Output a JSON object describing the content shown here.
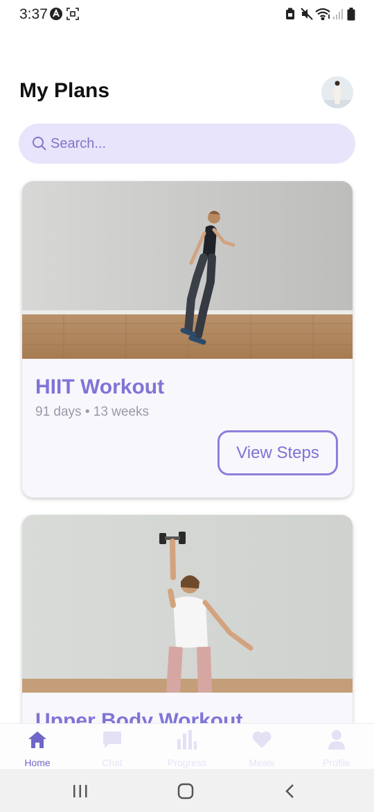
{
  "status_bar": {
    "time": "3:37",
    "icons": [
      "app-a-icon",
      "screenshot-icon",
      "battery-saver-icon",
      "mute-icon",
      "wifi-icon",
      "signal-icon",
      "battery-icon"
    ]
  },
  "header": {
    "title": "My Plans",
    "avatar": "avatar"
  },
  "search": {
    "placeholder": "Search..."
  },
  "plans": [
    {
      "title": "HIIT Workout",
      "meta": "91 days • 13 weeks",
      "button_label": "View Steps"
    },
    {
      "title": "Upper Body Workout"
    }
  ],
  "tabs": [
    {
      "label": "Home",
      "icon": "home-icon",
      "active": true
    },
    {
      "label": "Chat",
      "icon": "chat-icon",
      "active": false
    },
    {
      "label": "Progress",
      "icon": "bar-chart-icon",
      "active": false
    },
    {
      "label": "Meals",
      "icon": "heart-icon",
      "active": false
    },
    {
      "label": "Profile",
      "icon": "person-icon",
      "active": false
    }
  ],
  "system_nav": [
    "recent-apps-icon",
    "home-nav-icon",
    "back-icon"
  ],
  "colors": {
    "accent": "#7f74d6",
    "search_bg": "#e8e4fb",
    "card_bg": "#f8f7fc",
    "tab_active": "#6f66c9",
    "tab_inactive": "#e6e4f4"
  }
}
